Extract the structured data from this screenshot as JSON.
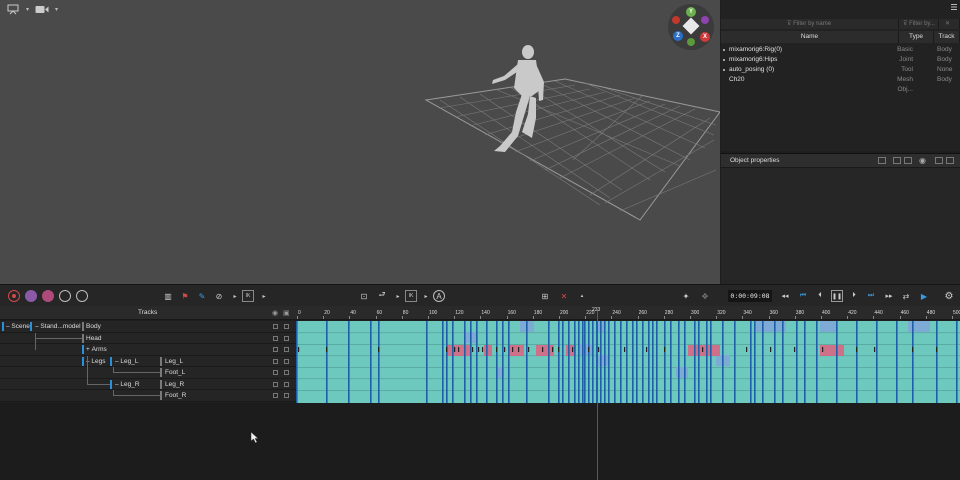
{
  "outliner": {
    "filter_name_placeholder": "Filter by name",
    "filter_type_placeholder": "Filter by...",
    "columns": {
      "name": "Name",
      "type": "Type",
      "track": "Track"
    },
    "rows": [
      {
        "name": "mixamorig6:Rig(0)",
        "type": "Basic",
        "track": "Body",
        "bullet": true
      },
      {
        "name": "mixamorig6:Hips",
        "type": "Joint",
        "track": "Body",
        "bullet": true
      },
      {
        "name": "auto_posing (0)",
        "type": "Tool",
        "track": "None",
        "bullet": true
      },
      {
        "name": "Ch20",
        "type": "Mesh Obj...",
        "track": "Body",
        "bullet": false
      }
    ]
  },
  "object_properties": {
    "title": "Object properties"
  },
  "transport": {
    "timecode": "0:00:09:08"
  },
  "tracks": {
    "title": "Tracks",
    "tree": {
      "scene": "Scene",
      "standard_model": "Stand...model",
      "body": "Body",
      "head": "Head",
      "arms": "Arms",
      "legs": "Legs",
      "leg_l_group": "Leg_L",
      "leg_l": "Leg_L",
      "foot_l": "Foot_L",
      "leg_r_group": "Leg_R",
      "leg_r": "Leg_R",
      "foot_r": "Foot_R"
    }
  },
  "ruler": {
    "ticks": [
      "0",
      "20",
      "40",
      "60",
      "80",
      "100",
      "120",
      "140",
      "160",
      "180",
      "200",
      "220",
      "240",
      "260",
      "280",
      "300",
      "320",
      "340",
      "360",
      "380",
      "400",
      "420",
      "440",
      "460",
      "480",
      "500"
    ],
    "current_frame": "233"
  },
  "colors": {
    "timeline_bg": "#6dc8bd",
    "keyframe_blue": "#1f5ea8",
    "selection_pink": "#e06080",
    "playhead": "#cc2a2a",
    "accent": "#2a90d8"
  }
}
